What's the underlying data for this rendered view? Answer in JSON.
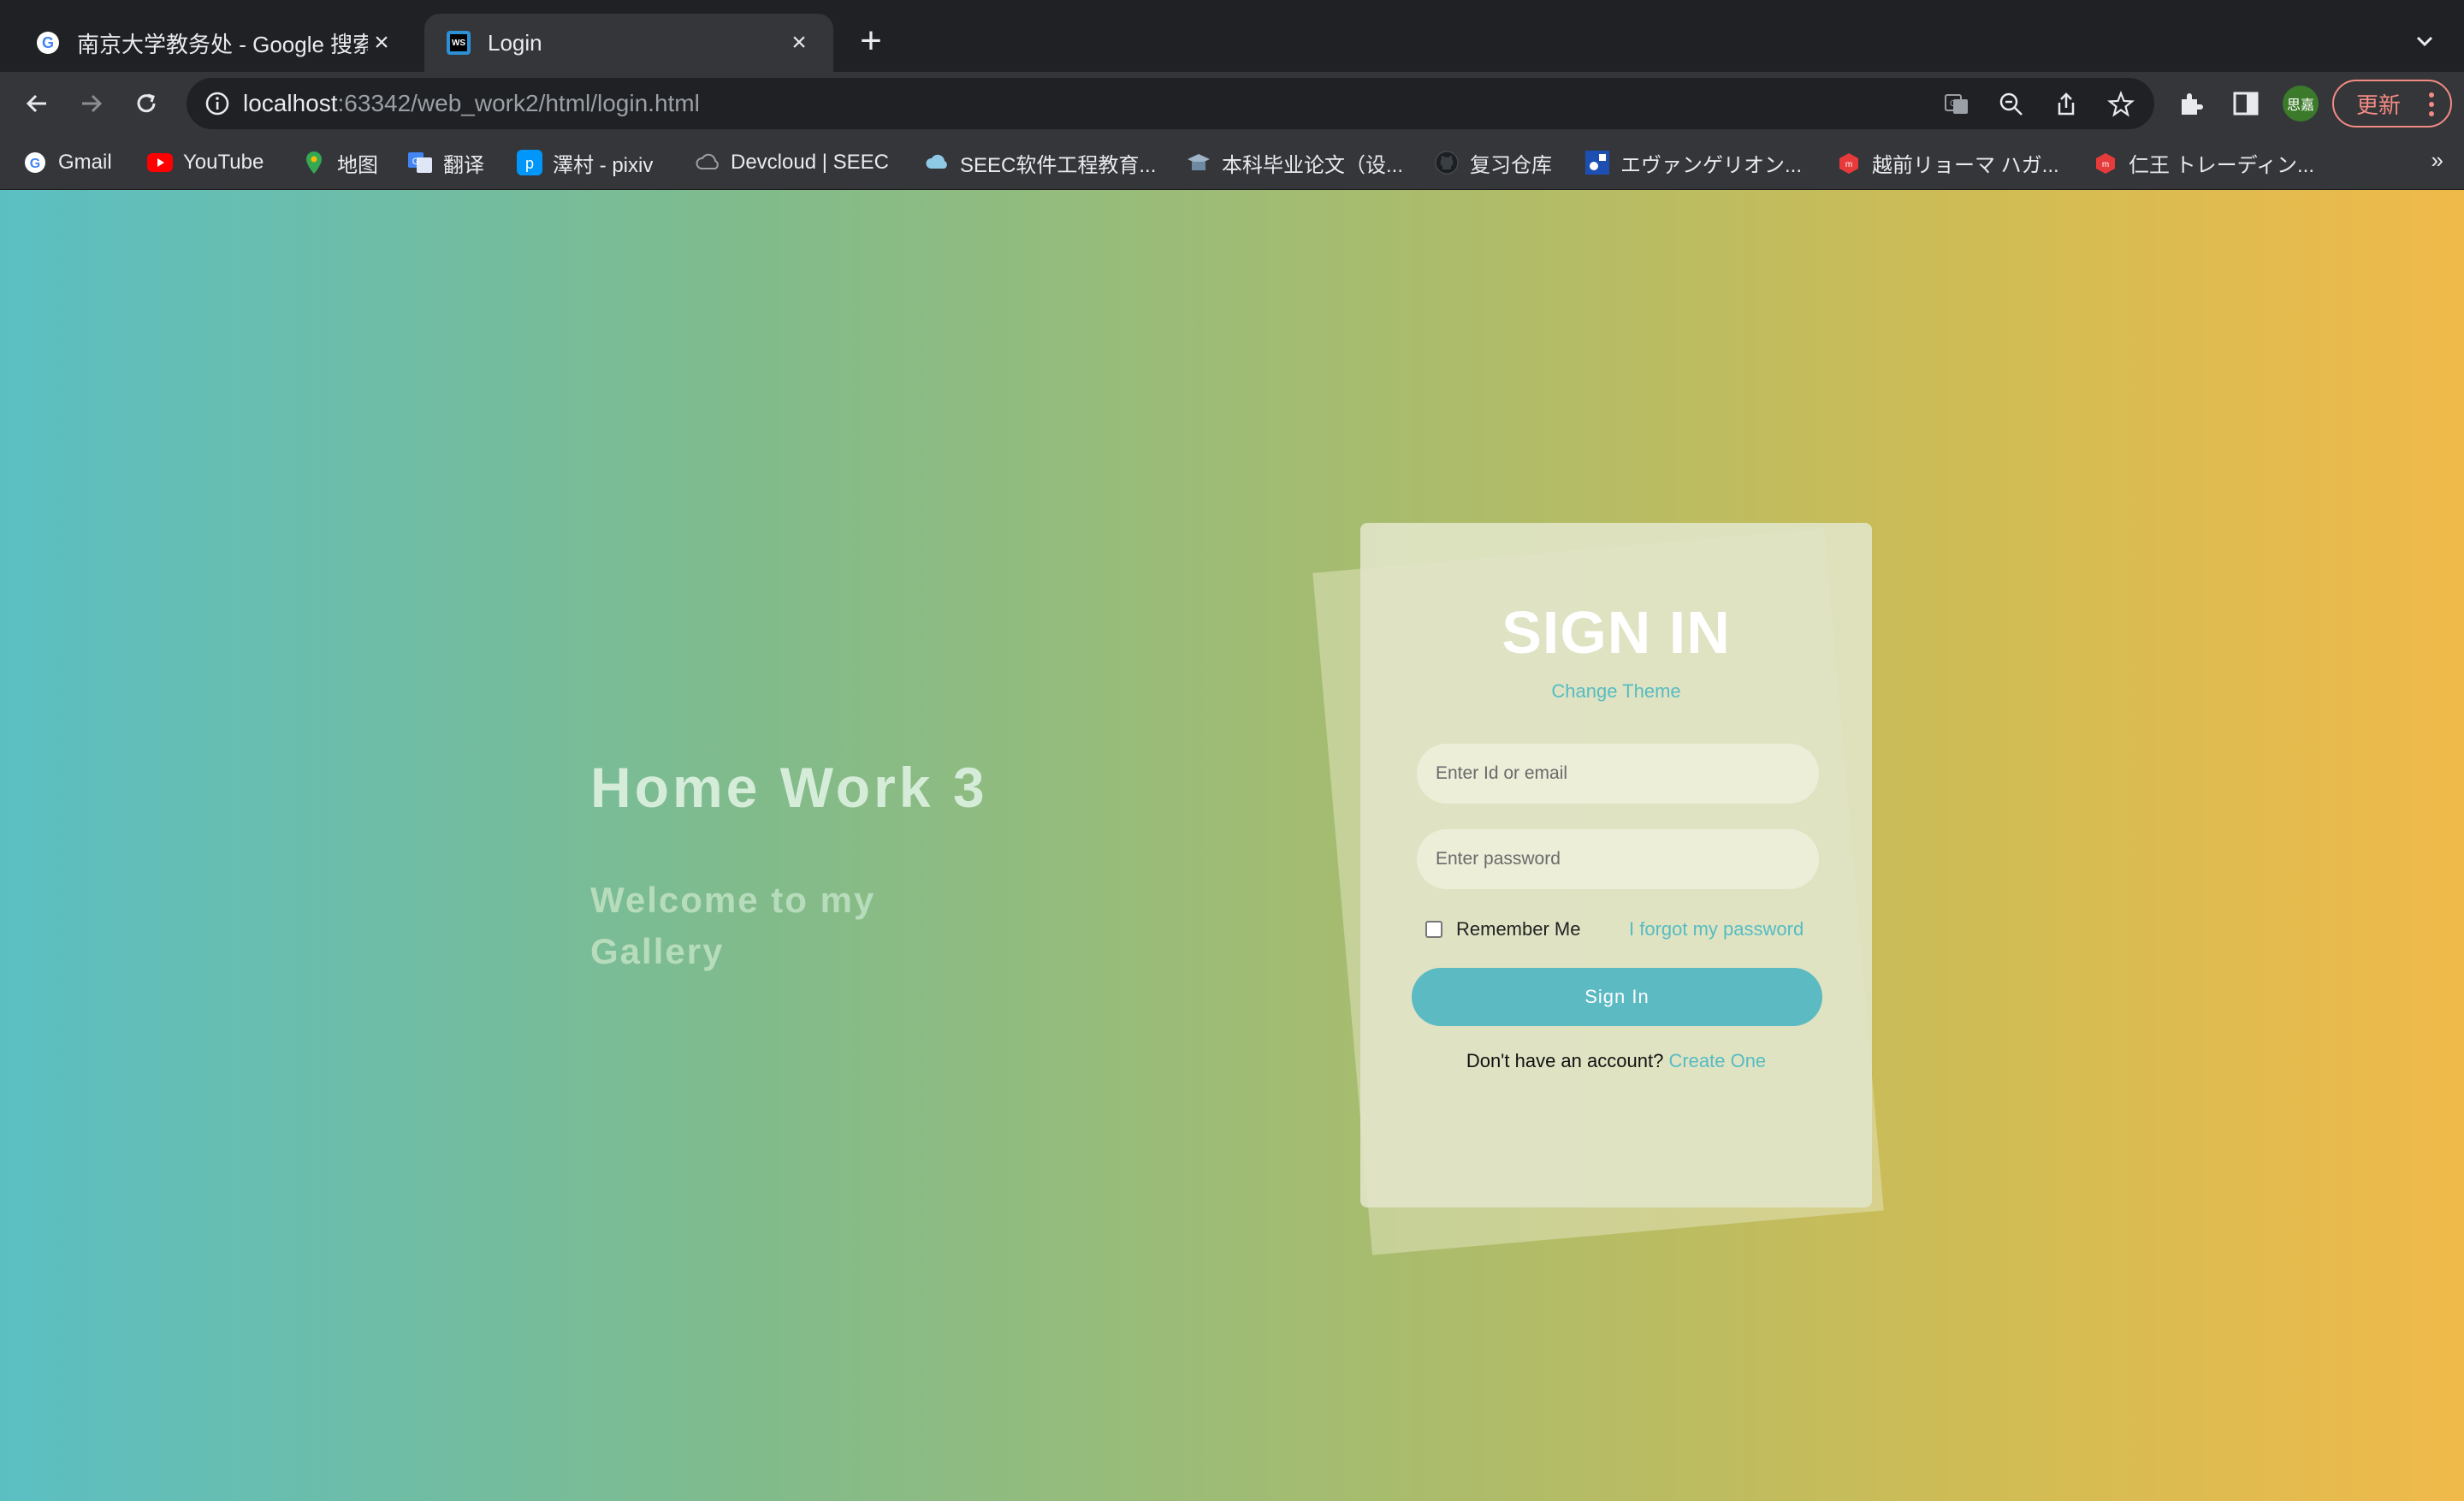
{
  "browser": {
    "tabs": [
      {
        "title": "南京大学教务处 - Google 搜索",
        "active": false,
        "icon": "google-icon"
      },
      {
        "title": "Login",
        "active": true,
        "icon": "webstorm-icon"
      }
    ],
    "url_host": "localhost",
    "url_path": ":63342/web_work2/html/login.html",
    "profile_initials": "思嘉",
    "update_label": "更新",
    "bookmarks": [
      {
        "label": "Gmail",
        "icon": "google-icon"
      },
      {
        "label": "YouTube",
        "icon": "youtube-icon"
      },
      {
        "label": "地图",
        "icon": "maps-icon"
      },
      {
        "label": "翻译",
        "icon": "translate-icon"
      },
      {
        "label": "澤村 - pixiv",
        "icon": "pixiv-icon"
      },
      {
        "label": "Devcloud | SEEC",
        "icon": "cloud-icon"
      },
      {
        "label": "SEEC软件工程教育...",
        "icon": "cloud-icon"
      },
      {
        "label": "本科毕业论文（设...",
        "icon": "graduation-icon"
      },
      {
        "label": "复习仓库",
        "icon": "github-icon"
      },
      {
        "label": "エヴァンゲリオン...",
        "icon": "site-icon"
      },
      {
        "label": "越前リョーマ ハガ...",
        "icon": "mercari-icon"
      },
      {
        "label": "仁王 トレーディン...",
        "icon": "mercari-icon"
      }
    ],
    "bookmarks_more": "»"
  },
  "page": {
    "hero_title": "Home Work 3",
    "hero_subtitle": "Welcome to my Gallery",
    "signin": {
      "title": "SIGN IN",
      "change_theme": "Change Theme",
      "id_placeholder": "Enter Id or email",
      "password_placeholder": "Enter password",
      "remember_me": "Remember Me",
      "forgot_password": "I forgot my password",
      "submit": "Sign In",
      "no_account": "Don't have an account?",
      "create": "Create One"
    }
  },
  "colors": {
    "gradient_start": "#5bbfc3",
    "gradient_end": "#f0ba4a",
    "accent": "#56bcc3"
  }
}
